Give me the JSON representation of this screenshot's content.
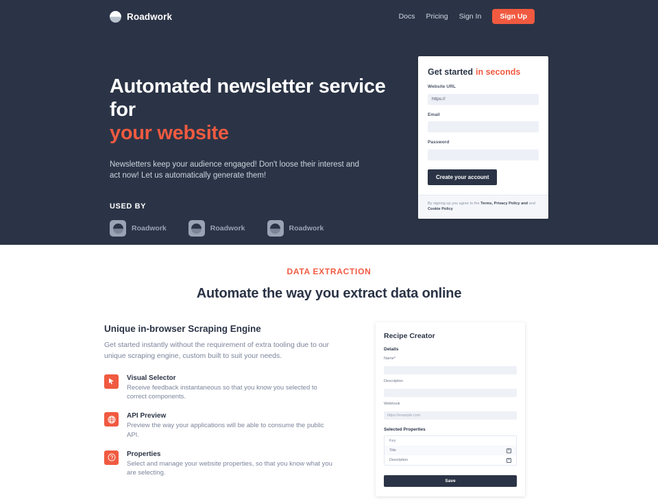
{
  "colors": {
    "dark_navy": "#2b3446",
    "accent_orange": "#f05a40",
    "input_bg": "#edf0f7",
    "muted_text": "#7b849a"
  },
  "navbar": {
    "brand": "Roadwork",
    "brand_icon": "roadwork-logo-icon",
    "links": [
      {
        "label": "Docs"
      },
      {
        "label": "Pricing"
      },
      {
        "label": "Sign In"
      }
    ],
    "signup_label": "Sign Up"
  },
  "hero": {
    "title_line1": "Automated newsletter service for",
    "title_line2": "your website",
    "subtitle": "Newsletters keep your audience engaged! Don't loose their interest and act now! Let us automatically generate them!",
    "used_by_label": "USED BY",
    "logos": [
      {
        "name": "Roadwork"
      },
      {
        "name": "Roadwork"
      },
      {
        "name": "Roadwork"
      }
    ]
  },
  "signup_card": {
    "title_main": "Get started",
    "title_accent": "in seconds",
    "fields": [
      {
        "label": "Website URL",
        "value": "https://",
        "placeholder": "https://"
      },
      {
        "label": "Email",
        "value": "",
        "placeholder": ""
      },
      {
        "label": "Password",
        "value": "",
        "placeholder": ""
      }
    ],
    "submit_label": "Create your account",
    "legal_prefix": "By signing up you agree to the ",
    "legal_link1": "Terms, Privacy Policy and",
    "legal_middle": " and ",
    "legal_link2": "Cookie Policy"
  },
  "extract": {
    "eyebrow": "DATA EXTRACTION",
    "title": "Automate the way you extract data online",
    "feature_head": "Unique in-browser Scraping Engine",
    "feature_sub": "Get started instantly without the requirement of extra tooling due to our unique scraping engine, custom built to suit your needs.",
    "features": [
      {
        "icon": "play-cursor-icon",
        "title": "Visual Selector",
        "desc": "Receive feedback instantaneous so that you know you selected to correct components."
      },
      {
        "icon": "globe-icon",
        "title": "API Preview",
        "desc": "Preview the way your applications will be able to consume the public API."
      },
      {
        "icon": "question-circle-icon",
        "title": "Properties",
        "desc": "Select and manage your website properties, so that you know what you are selecting."
      }
    ]
  },
  "recipe_card": {
    "title": "Recipe Creator",
    "details_label": "Details",
    "fields": [
      {
        "label": "Name*",
        "value": "",
        "placeholder": ""
      },
      {
        "label": "Description",
        "value": "",
        "placeholder": ""
      },
      {
        "label": "Webhook",
        "value": "",
        "placeholder": "https://example.com"
      }
    ],
    "properties_label": "Selected Properties",
    "properties_header": "Key",
    "properties": [
      {
        "key": "Title",
        "delete_label": "×"
      },
      {
        "key": "Description",
        "delete_label": "×"
      }
    ],
    "save_label": "Save"
  }
}
